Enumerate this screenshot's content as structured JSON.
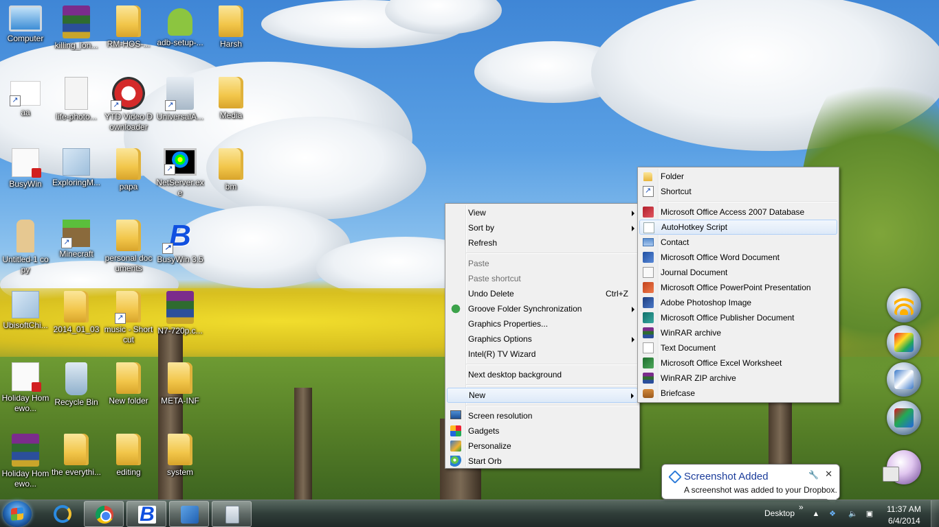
{
  "desktop_icons": [
    {
      "label": "Computer"
    },
    {
      "label": "killing_lon..."
    },
    {
      "label": "RM-HOS-..."
    },
    {
      "label": "adb-setup-..."
    },
    {
      "label": "Harsh"
    },
    {
      "label": "aa"
    },
    {
      "label": "life-photo..."
    },
    {
      "label": "YTD Video Downloader"
    },
    {
      "label": "UniversalA..."
    },
    {
      "label": "Media"
    },
    {
      "label": "BusyWin"
    },
    {
      "label": "ExploringM..."
    },
    {
      "label": "papa"
    },
    {
      "label": "NetServer.exe"
    },
    {
      "label": "bm"
    },
    {
      "label": "Untitled-1 copy"
    },
    {
      "label": "Minecraft"
    },
    {
      "label": "personal documents"
    },
    {
      "label": "BusyWin 3.5"
    },
    {
      "label": "UbisoftChi..."
    },
    {
      "label": "2014_01_03"
    },
    {
      "label": "music - Shortcut"
    },
    {
      "label": "N7-720p.c..."
    },
    {
      "label": "Holiday Homewo..."
    },
    {
      "label": "Recycle Bin"
    },
    {
      "label": "New folder"
    },
    {
      "label": "META-INF"
    },
    {
      "label": "Holiday Homewo..."
    },
    {
      "label": "the everythi..."
    },
    {
      "label": "editing"
    },
    {
      "label": "system"
    }
  ],
  "context_menu": {
    "items": [
      {
        "label": "View"
      },
      {
        "label": "Sort by"
      },
      {
        "label": "Refresh"
      },
      {
        "label": "Paste"
      },
      {
        "label": "Paste shortcut"
      },
      {
        "label": "Undo Delete",
        "shortcut": "Ctrl+Z"
      },
      {
        "label": "Groove Folder Synchronization"
      },
      {
        "label": "Graphics Properties..."
      },
      {
        "label": "Graphics Options"
      },
      {
        "label": "Intel(R) TV Wizard"
      },
      {
        "label": "Next desktop background"
      },
      {
        "label": "New"
      },
      {
        "label": "Screen resolution"
      },
      {
        "label": "Gadgets"
      },
      {
        "label": "Personalize"
      },
      {
        "label": "Start Orb"
      }
    ]
  },
  "new_submenu": {
    "items": [
      {
        "label": "Folder",
        "icon": "folder-icon"
      },
      {
        "label": "Shortcut",
        "icon": "shortcut-icon"
      },
      {
        "label": "Microsoft Office Access 2007 Database",
        "icon": "access-icon"
      },
      {
        "label": "AutoHotkey Script",
        "icon": "autohotkey-icon"
      },
      {
        "label": "Contact",
        "icon": "contact-icon"
      },
      {
        "label": "Microsoft Office Word Document",
        "icon": "word-icon"
      },
      {
        "label": "Journal Document",
        "icon": "journal-icon"
      },
      {
        "label": "Microsoft Office PowerPoint Presentation",
        "icon": "powerpoint-icon"
      },
      {
        "label": "Adobe Photoshop Image",
        "icon": "photoshop-icon"
      },
      {
        "label": "Microsoft Office Publisher Document",
        "icon": "publisher-icon"
      },
      {
        "label": "WinRAR archive",
        "icon": "winrar-icon"
      },
      {
        "label": "Text Document",
        "icon": "text-document-icon"
      },
      {
        "label": "Microsoft Office Excel Worksheet",
        "icon": "excel-icon"
      },
      {
        "label": "WinRAR ZIP archive",
        "icon": "winrar-zip-icon"
      },
      {
        "label": "Briefcase",
        "icon": "briefcase-icon"
      }
    ]
  },
  "notification": {
    "title": "Screenshot Added",
    "body": "A screenshot was added to your Dropbox.",
    "close": "✕"
  },
  "taskbar": {
    "desktop_label": "Desktop",
    "chevron": "»",
    "time": "11:37 AM",
    "date": "6/4/2014"
  },
  "colors": {
    "taskbar": "#1e2d2a",
    "menu_bg": "#f0f0f0",
    "highlight_border": "#aecff7",
    "balloon_title": "#1b3c9a"
  }
}
